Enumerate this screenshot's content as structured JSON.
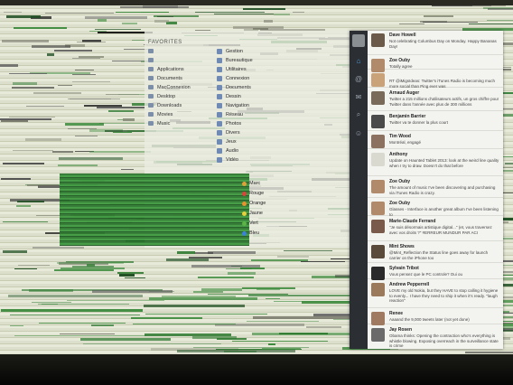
{
  "finder": {
    "sidebar_header": "FAVORITES",
    "sidebar_items": [
      "",
      "",
      "Applications",
      "Documents",
      "MacConnexion",
      "Desktop",
      "Downloads",
      "Movies",
      "Music"
    ],
    "file_rows": [
      "Gestion",
      "Bureautique",
      "Utilitaires",
      "Connexion",
      "Documents",
      "Dessin",
      "Navigation",
      "Réseau",
      "Photos",
      "Divers",
      "Jeux",
      "Audio",
      "Vidéo"
    ],
    "tags": [
      {
        "label": "Marc",
        "color": "#e0a038"
      },
      {
        "label": "Rouge",
        "color": "#d8453b"
      },
      {
        "label": "Orange",
        "color": "#e8912d"
      },
      {
        "label": "Jaune",
        "color": "#e6cf3a"
      },
      {
        "label": "Vert",
        "color": "#5bb546"
      },
      {
        "label": "Bleu",
        "color": "#3b82d8"
      }
    ]
  },
  "twitter": {
    "rail_icons": [
      "home-icon",
      "mentions-icon",
      "messages-icon",
      "search-icon",
      "profile-icon"
    ],
    "tweets": [
      {
        "name": "Dave Howell",
        "text": "Not celebrating Columbus Day on Monday. Happy Bananas Day!",
        "color": "#6b5a4a"
      },
      {
        "name": "Zoe Ouby",
        "text": "Totally agree",
        "color": "#b08a6a"
      },
      {
        "name": "",
        "text": "RT @iMigsIdeas: Twitter's iTunes Radio is becoming much more social than Ping ever was",
        "color": "#c9a27a"
      },
      {
        "name": "Arnaud Auger",
        "text": "Twitter a 215 millions d'utilisateurs actifs, un gros chiffre pour Twitter dans l'année avec plus de 300 millions",
        "color": "#7a6a5a"
      },
      {
        "name": "Benjamin Barrier",
        "text": "Twitter va te donner la plus court",
        "color": "#4a4a4a"
      },
      {
        "name": "Tim Wood",
        "text": "Montréal, engagé",
        "color": "#8c7060"
      },
      {
        "name": "Anthony",
        "text": "Update on Haunted Tablet 2013: look at the weird line quality when I try to draw. Doesn't do that before",
        "color": "#d9d9d0"
      },
      {
        "name": "Zoe Ouby",
        "text": "The amount of music I've been discovering and purchasing via iTunes Radio is crazy.",
        "color": "#b08a6a"
      },
      {
        "name": "Zoe Ouby",
        "text": "Glasses - Interface is another great album I've been listening to",
        "color": "#b08a6a"
      },
      {
        "name": "Marie-Claude Ferrand",
        "text": "\"Je suis désormais artistique digital...\" (et, vous traversez avec vos droits ?\" #ERREUR MUNDUR PAR ACI",
        "color": "#7a5a4a"
      },
      {
        "name": "Mint Shows",
        "text": "@Mint_Reflection the Status line goes away for launch carrier on the iPhone too",
        "color": "#5a4a3a"
      },
      {
        "name": "Sylvain Tribot",
        "text": "Vous pensez que le PC controle? Oui ou",
        "color": "#2a2a2a"
      },
      {
        "name": "Andrew Pepperrell",
        "text": "LOVE my old Nokia, but they HAVE to stop calling it hygiene to evenly... I have they need to ship it when it's ready. \"laugh reaction\"",
        "color": "#9a7a5a"
      },
      {
        "name": "Renee",
        "text": "Aaaand the 9,000 tweets later (not yet done)",
        "color": "#a07a60"
      },
      {
        "name": "Jay Rosen",
        "text": "Obama thinks: Opening the contraction who's everything is whistle blowing. Exposing overreach in the surveillance state is crime",
        "color": "#6a6a6a"
      }
    ]
  }
}
